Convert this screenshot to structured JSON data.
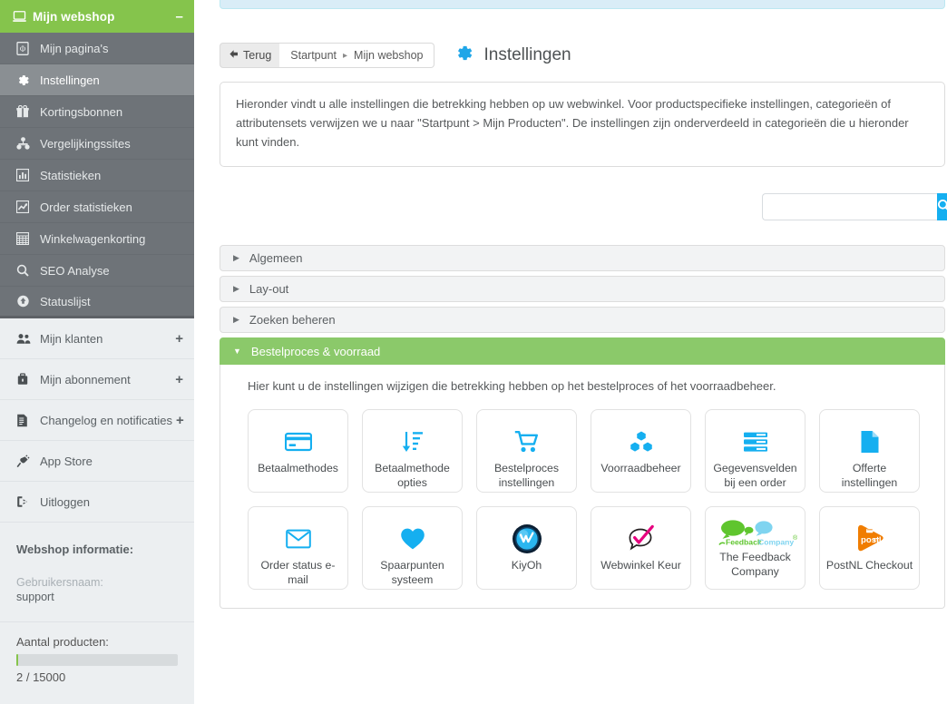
{
  "sidebar": {
    "header": {
      "label": "Mijn webshop",
      "icon": "laptop-icon",
      "collapse": "–"
    },
    "dark_items": [
      {
        "label": "Mijn pagina's",
        "icon": "page-icon",
        "active": false
      },
      {
        "label": "Instellingen",
        "icon": "gear-icon",
        "active": true
      },
      {
        "label": "Kortingsbonnen",
        "icon": "gift-icon",
        "active": false
      },
      {
        "label": "Vergelijkingssites",
        "icon": "sitemap-icon",
        "active": false
      },
      {
        "label": "Statistieken",
        "icon": "bar-chart-icon",
        "active": false
      },
      {
        "label": "Order statistieken",
        "icon": "line-chart-icon",
        "active": false
      },
      {
        "label": "Winkelwagenkorting",
        "icon": "table-icon",
        "active": false
      },
      {
        "label": "SEO Analyse",
        "icon": "search-icon",
        "active": false
      },
      {
        "label": "Statuslijst",
        "icon": "cloud-upload-icon",
        "active": false
      }
    ],
    "light_items": [
      {
        "label": "Mijn klanten",
        "icon": "users-icon",
        "expand": "+"
      },
      {
        "label": "Mijn abonnement",
        "icon": "briefcase-icon",
        "expand": "+"
      },
      {
        "label": "Changelog en notificaties",
        "icon": "document-icon",
        "expand": "+"
      },
      {
        "label": "App Store",
        "icon": "plug-icon",
        "expand": ""
      },
      {
        "label": "Uitloggen",
        "icon": "logout-icon",
        "expand": ""
      }
    ],
    "info": {
      "title": "Webshop informatie:",
      "username_label": "Gebruikersnaam:",
      "username_value": "support",
      "products_label": "Aantal producten:",
      "products_value": "2 / 15000"
    }
  },
  "header": {
    "back_label": "Terug",
    "back_icon": "arrow-left-icon",
    "breadcrumb_root": "Startpunt",
    "breadcrumb_sep": "▸",
    "breadcrumb_current": "Mijn webshop",
    "title": "Instellingen",
    "title_icon": "gear-icon"
  },
  "intro": {
    "text": "Hieronder vindt u alle instellingen die betrekking hebben op uw webwinkel. Voor productspecifieke instellingen, categorieën of attributensets verwijzen we u naar \"Startpunt > Mijn Producten\". De instellingen zijn onderverdeeld in categorieën die u hieronder kunt vinden."
  },
  "search": {
    "value": "",
    "placeholder": "",
    "button_icon": "search-icon"
  },
  "accordion": {
    "sections": [
      {
        "label": "Algemeen",
        "open": false
      },
      {
        "label": "Lay-out",
        "open": false
      },
      {
        "label": "Zoeken beheren",
        "open": false
      },
      {
        "label": "Bestelproces & voorraad",
        "open": true
      }
    ],
    "open_section": {
      "description": "Hier kunt u de instellingen wijzigen die betrekking hebben op het bestelproces of het voorraadbeheer.",
      "tiles": [
        {
          "label": "Betaalmethodes",
          "icon": "credit-card-icon"
        },
        {
          "label": "Betaalmethode opties",
          "icon": "sort-amount-down-icon"
        },
        {
          "label": "Bestelproces instellingen",
          "icon": "shopping-cart-icon"
        },
        {
          "label": "Voorraadbeheer",
          "icon": "cubes-icon"
        },
        {
          "label": "Gegevensvelden bij een order",
          "icon": "server-list-icon"
        },
        {
          "label": "Offerte instellingen",
          "icon": "file-icon"
        },
        {
          "label": "Order status e-mail",
          "icon": "envelope-icon"
        },
        {
          "label": "Spaarpunten systeem",
          "icon": "heart-icon"
        },
        {
          "label": "KiyOh",
          "icon": "kiyoh-logo"
        },
        {
          "label": "Webwinkel Keur",
          "icon": "webwinkelkeur-logo"
        },
        {
          "label": "The Feedback Company",
          "icon": "feedback-company-logo"
        },
        {
          "label": "PostNL Checkout",
          "icon": "postnl-logo"
        }
      ]
    }
  },
  "colors": {
    "brand_green": "#85c44c",
    "accent_blue": "#15aff0",
    "sidebar_dark": "#6e7378",
    "sidebar_light": "#eceff1",
    "accordion_open": "#8bc96a",
    "alert_blue": "#d9edf7",
    "postnl_orange": "#f07d00",
    "keur_pink": "#e6007e",
    "feedback_green": "#5fc52e"
  }
}
